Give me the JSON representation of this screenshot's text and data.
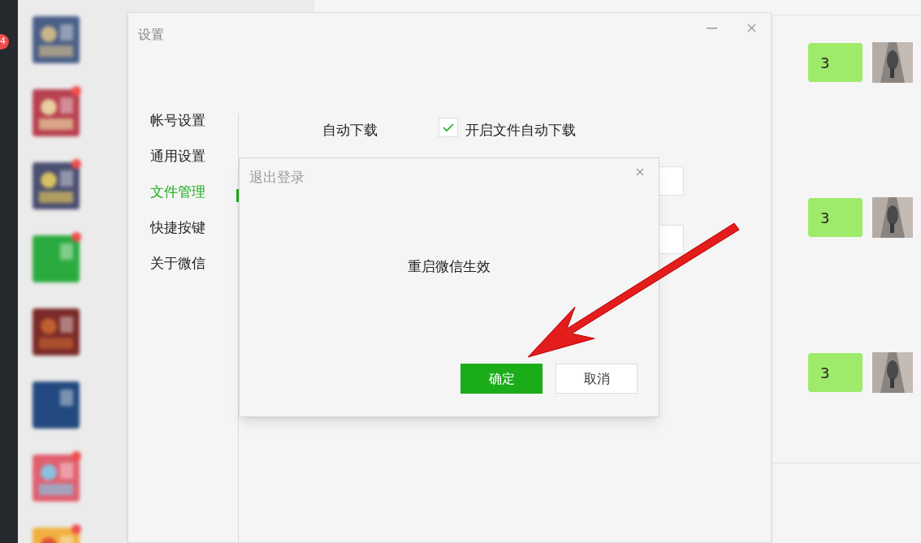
{
  "dock": {
    "badge": "4"
  },
  "chat_list": {
    "items": [
      {
        "kind": "picture",
        "unread": false
      },
      {
        "kind": "picture",
        "unread": true
      },
      {
        "kind": "picture",
        "unread": true
      },
      {
        "kind": "picture",
        "unread": true
      },
      {
        "kind": "picture",
        "unread": false
      },
      {
        "kind": "picture",
        "unread": false
      },
      {
        "kind": "picture",
        "unread": true
      },
      {
        "kind": "picture",
        "unread": true
      }
    ]
  },
  "chat": {
    "messages": [
      {
        "text": "3"
      },
      {
        "text": "3"
      },
      {
        "text": "3"
      }
    ]
  },
  "settings": {
    "title": "设置",
    "sidebar": {
      "items": [
        {
          "label": "帐号设置",
          "selected": false
        },
        {
          "label": "通用设置",
          "selected": false
        },
        {
          "label": "文件管理",
          "selected": true
        },
        {
          "label": "快捷按键",
          "selected": false
        },
        {
          "label": "关于微信",
          "selected": false
        }
      ]
    },
    "auto_download": {
      "label": "自动下载",
      "checkbox": {
        "label": "开启文件自动下载",
        "checked": true
      }
    }
  },
  "dialog": {
    "title": "退出登录",
    "message": "重启微信生效",
    "buttons": [
      {
        "label": "确定",
        "kind": "primary"
      },
      {
        "label": "取消",
        "kind": "secondary"
      }
    ]
  }
}
